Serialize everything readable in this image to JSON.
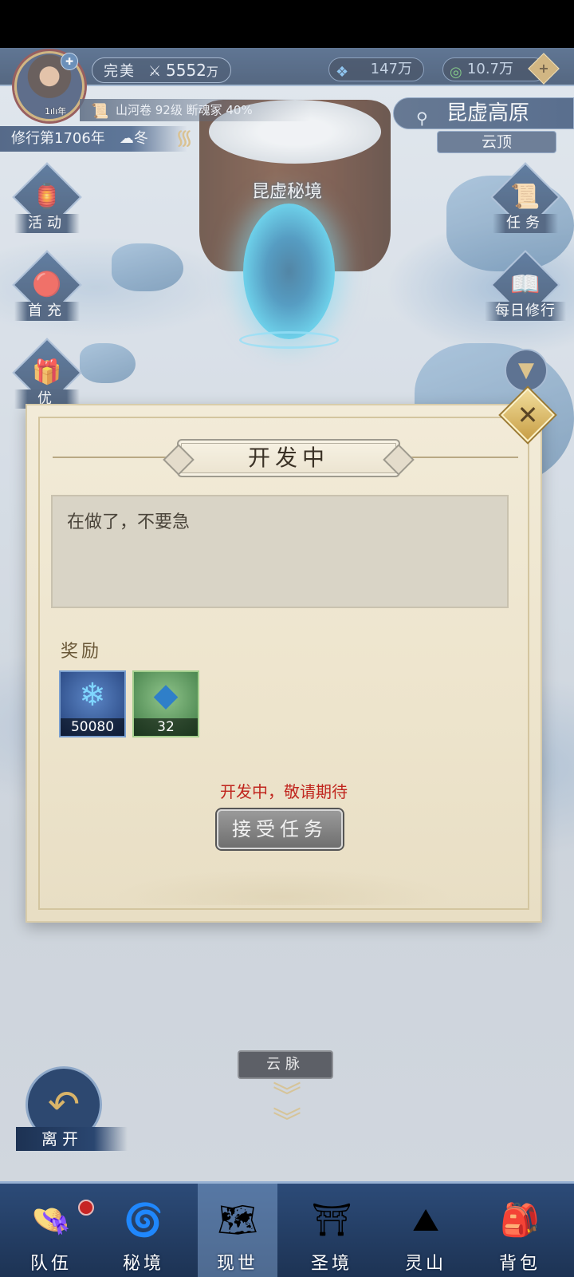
{
  "header": {
    "rank_label": "完美",
    "power_value": "5552",
    "power_unit": "万",
    "avatar_years": "1ılı年",
    "currencies": [
      {
        "icon": "crystal-icon",
        "value": "147万"
      },
      {
        "icon": "jade-coin-icon",
        "value": "10.7万"
      }
    ],
    "plus_symbol": "+",
    "scroll_info": "山河卷 92级 断魂冢 40%",
    "cultivation_year": "修行第1706年",
    "season": "冬"
  },
  "location": {
    "main": "昆虚高原",
    "sub": "云顶"
  },
  "scene": {
    "portal_label": "昆虚秘境"
  },
  "side_left": [
    {
      "label": "活动",
      "icon": "event-icon"
    },
    {
      "label": "首充",
      "icon": "first-recharge-icon"
    },
    {
      "label": "优",
      "icon": "gift-box-icon"
    }
  ],
  "side_right": [
    {
      "label": "任务",
      "icon": "quest-scroll-icon"
    },
    {
      "label": "每日修行",
      "icon": "daily-book-icon"
    }
  ],
  "dialog": {
    "title": "开发中",
    "description": "在做了，不要急",
    "reward_title": "奖励",
    "rewards": [
      {
        "icon": "blue-crystal-icon",
        "qty": "50080"
      },
      {
        "icon": "blue-shard-icon",
        "qty": "32"
      }
    ],
    "notice": "开发中，敬请期待",
    "accept_button": "接受任务",
    "close_symbol": "✕"
  },
  "bottom": {
    "vein_button": "云脉",
    "leave_label": "离开",
    "nav": [
      {
        "label": "队伍",
        "icon": "team-icon",
        "badge": true,
        "active": false
      },
      {
        "label": "秘境",
        "icon": "secret-realm-icon",
        "badge": false,
        "active": false
      },
      {
        "label": "现世",
        "icon": "world-map-icon",
        "badge": false,
        "active": true
      },
      {
        "label": "圣境",
        "icon": "holy-palace-icon",
        "badge": false,
        "active": false
      },
      {
        "label": "灵山",
        "icon": "spirit-mountain-icon",
        "badge": false,
        "active": false
      },
      {
        "label": "背包",
        "icon": "backpack-icon",
        "badge": false,
        "active": false
      }
    ]
  },
  "colors": {
    "hud_blue": "#1e3658",
    "parchment": "#efe7d2",
    "notice_red": "#c0261e",
    "gold": "#c9a25a"
  }
}
